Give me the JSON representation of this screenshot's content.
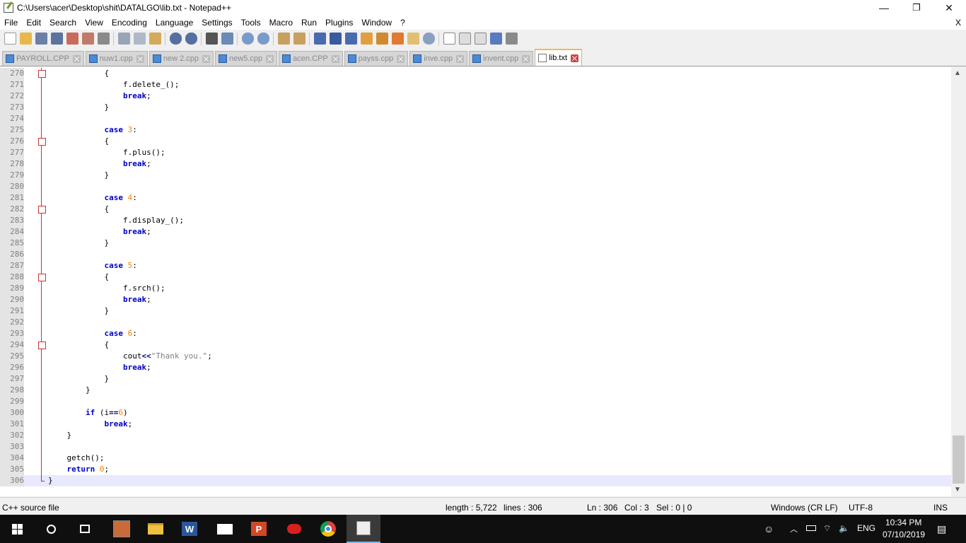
{
  "window": {
    "title": "C:\\Users\\acer\\Desktop\\shit\\DATALGO\\lib.txt - Notepad++",
    "minimize": "—",
    "maximize": "❐",
    "close": "✕",
    "doc_close": "X"
  },
  "menu": [
    "File",
    "Edit",
    "Search",
    "View",
    "Encoding",
    "Language",
    "Settings",
    "Tools",
    "Macro",
    "Run",
    "Plugins",
    "Window",
    "?"
  ],
  "tabs": [
    {
      "label": "PAYROLL.CPP",
      "active": false
    },
    {
      "label": "nuw1.cpp",
      "active": false
    },
    {
      "label": "new 2.cpp",
      "active": false
    },
    {
      "label": "new5.cpp",
      "active": false
    },
    {
      "label": "acen.CPP",
      "active": false
    },
    {
      "label": "payss.cpp",
      "active": false
    },
    {
      "label": "inve.cpp",
      "active": false
    },
    {
      "label": "invent.cpp",
      "active": false
    },
    {
      "label": "lib.txt",
      "active": true
    }
  ],
  "editor": {
    "current_line": "306",
    "lines": [
      {
        "n": "270",
        "code": "            {"
      },
      {
        "n": "271",
        "code": "                f.delete_();"
      },
      {
        "n": "272",
        "code": "                break;"
      },
      {
        "n": "273",
        "code": "            }"
      },
      {
        "n": "274",
        "code": ""
      },
      {
        "n": "275",
        "code": "            case 3:"
      },
      {
        "n": "276",
        "code": "            {"
      },
      {
        "n": "277",
        "code": "                f.plus();"
      },
      {
        "n": "278",
        "code": "                break;"
      },
      {
        "n": "279",
        "code": "            }"
      },
      {
        "n": "280",
        "code": ""
      },
      {
        "n": "281",
        "code": "            case 4:"
      },
      {
        "n": "282",
        "code": "            {"
      },
      {
        "n": "283",
        "code": "                f.display_();"
      },
      {
        "n": "284",
        "code": "                break;"
      },
      {
        "n": "285",
        "code": "            }"
      },
      {
        "n": "286",
        "code": ""
      },
      {
        "n": "287",
        "code": "            case 5:"
      },
      {
        "n": "288",
        "code": "            {"
      },
      {
        "n": "289",
        "code": "                f.srch();"
      },
      {
        "n": "290",
        "code": "                break;"
      },
      {
        "n": "291",
        "code": "            }"
      },
      {
        "n": "292",
        "code": ""
      },
      {
        "n": "293",
        "code": "            case 6:"
      },
      {
        "n": "294",
        "code": "            {"
      },
      {
        "n": "295",
        "code": "                cout<<\"Thank you.\";"
      },
      {
        "n": "296",
        "code": "                break;"
      },
      {
        "n": "297",
        "code": "            }"
      },
      {
        "n": "298",
        "code": "        }"
      },
      {
        "n": "299",
        "code": ""
      },
      {
        "n": "300",
        "code": "        if (i==6)"
      },
      {
        "n": "301",
        "code": "            break;"
      },
      {
        "n": "302",
        "code": "    }"
      },
      {
        "n": "303",
        "code": ""
      },
      {
        "n": "304",
        "code": "    getch();"
      },
      {
        "n": "305",
        "code": "    return 0;"
      },
      {
        "n": "306",
        "code": "}"
      }
    ]
  },
  "status": {
    "file_type": "C++ source file",
    "length": "length : 5,722",
    "lines": "lines : 306",
    "ln": "Ln : 306",
    "col": "Col : 3",
    "sel": "Sel : 0 | 0",
    "eol": "Windows (CR LF)",
    "encoding": "UTF-8",
    "mode": "INS"
  },
  "taskbar": {
    "lang": "ENG",
    "time": "10:34 PM",
    "date": "07/10/2019"
  },
  "colors": {
    "keyword": "#0000c8",
    "number": "#ff8000",
    "string": "#808080",
    "active_tab_accent": "#fab54c",
    "current_line": "#e8e8ff"
  }
}
